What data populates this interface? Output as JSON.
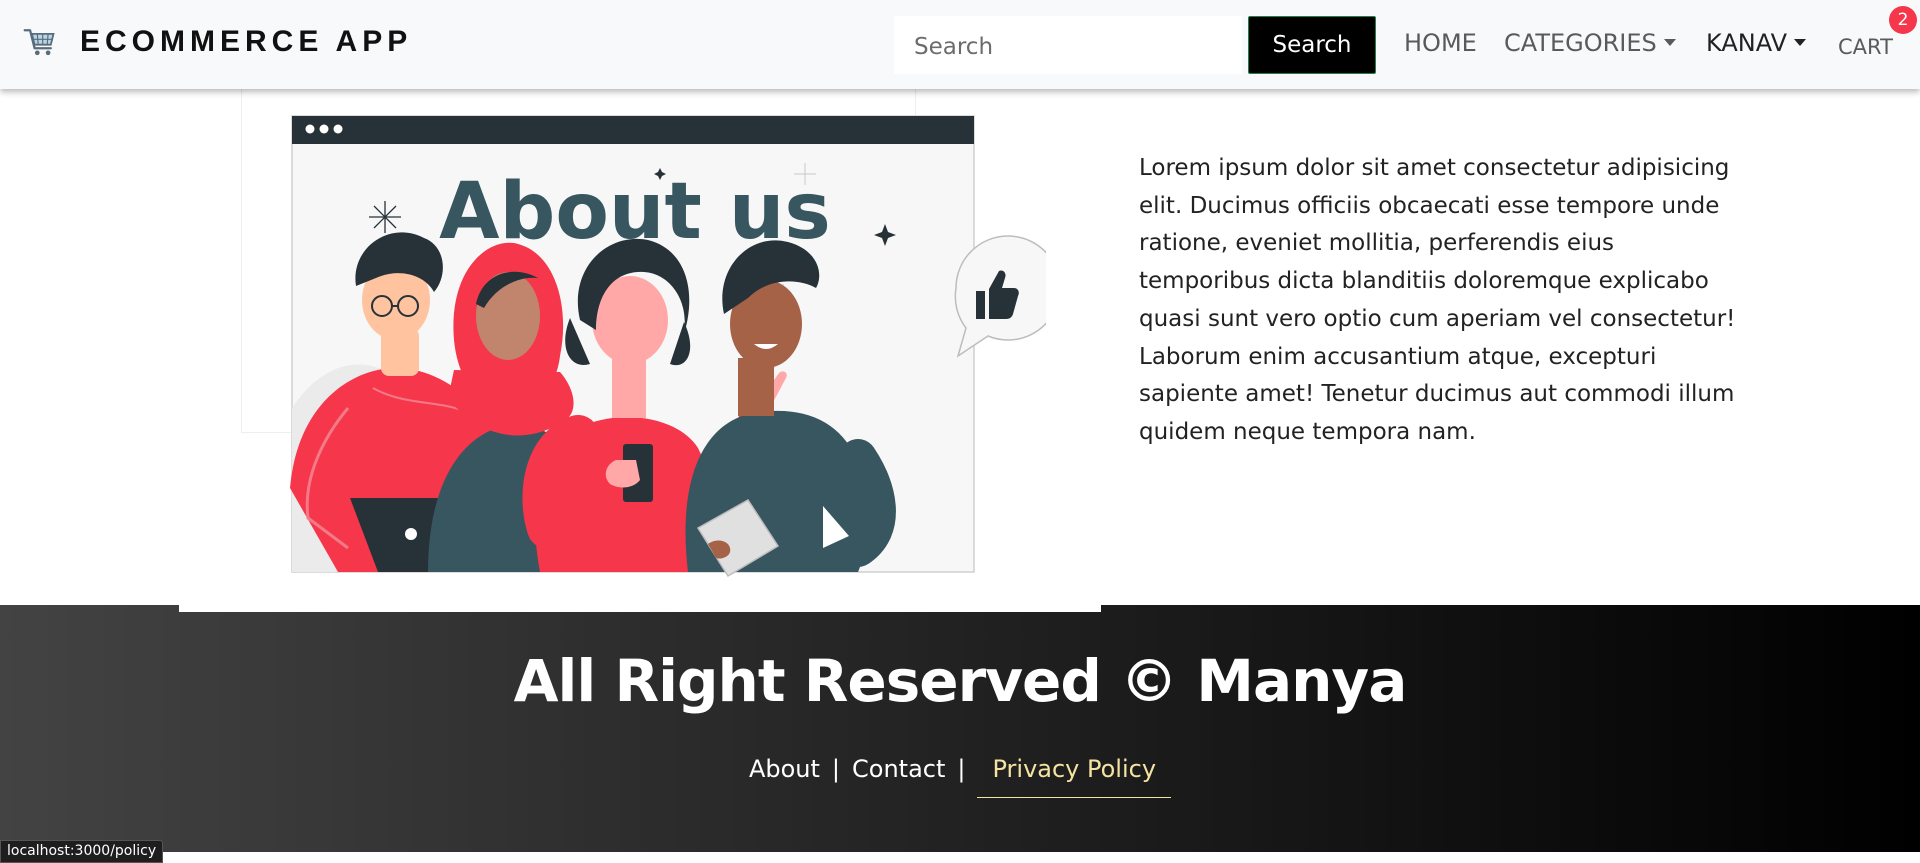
{
  "navbar": {
    "brand": "ECOMMERCE APP",
    "search_placeholder": "Search",
    "search_button": "Search",
    "home": "HOME",
    "categories": "CATEGORIES",
    "user": "KANAV",
    "cart": "CART",
    "cart_count": "2",
    "brand_icon": "shopping-cart-icon"
  },
  "illustration": {
    "heading": "About us"
  },
  "main": {
    "paragraph": "Lorem ipsum dolor sit amet consectetur adipisicing elit. Ducimus officiis obcaecati esse tempore unde ratione, eveniet mollitia, perferendis eius temporibus dicta blanditiis doloremque explicabo quasi sunt vero optio cum aperiam vel consectetur! Laborum enim accusantium atque, excepturi sapiente amet! Tenetur ducimus aut commodi illum quidem neque tempora nam."
  },
  "footer": {
    "copyright": "All Right Reserved © Manya",
    "links": [
      "About",
      "Contact",
      "Privacy Policy"
    ],
    "separator": "|"
  },
  "status_bar": {
    "url": "localhost:3000/policy"
  },
  "colors": {
    "navbar_bg": "#f8f9fa",
    "accent_red": "#f5364b",
    "footer_active_link": "#f5e3a2",
    "illustration_teal": "#37565f"
  }
}
